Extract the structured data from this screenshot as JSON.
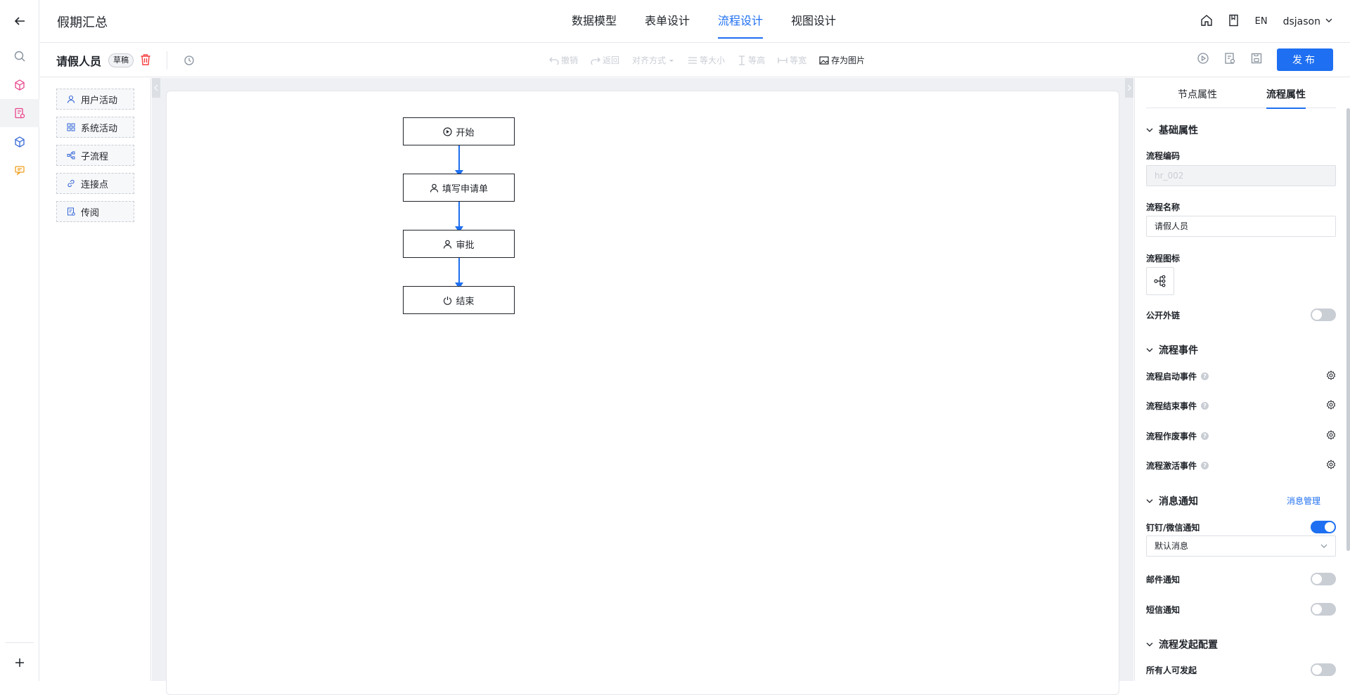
{
  "header": {
    "app_title": "假期汇总",
    "tabs": [
      {
        "label": "数据模型"
      },
      {
        "label": "表单设计"
      },
      {
        "label": "流程设计",
        "active": true
      },
      {
        "label": "视图设计"
      }
    ],
    "lang": "EN",
    "user": "dsjason"
  },
  "toolbar": {
    "flow_name": "请假人员",
    "status_badge": "草稿",
    "undo": "撤销",
    "redo": "返回",
    "align": "对齐方式",
    "same_size": "等大小",
    "same_height": "等高",
    "same_width": "等宽",
    "save_image": "存为图片",
    "publish": "发布"
  },
  "palette": {
    "items": [
      {
        "label": "用户活动",
        "icon": "user-icon"
      },
      {
        "label": "系统活动",
        "icon": "grid-icon"
      },
      {
        "label": "子流程",
        "icon": "subprocess-icon"
      },
      {
        "label": "连接点",
        "icon": "link-icon"
      },
      {
        "label": "传阅",
        "icon": "circulate-icon"
      }
    ]
  },
  "canvas": {
    "nodes": [
      {
        "label": "开始",
        "icon": "play-circle-icon"
      },
      {
        "label": "填写申请单",
        "icon": "user-icon"
      },
      {
        "label": "审批",
        "icon": "user-icon"
      },
      {
        "label": "结束",
        "icon": "power-icon"
      }
    ]
  },
  "panel": {
    "tabs": [
      {
        "label": "节点属性"
      },
      {
        "label": "流程属性",
        "active": true
      }
    ],
    "basic": {
      "title": "基础属性",
      "code_label": "流程编码",
      "code_value": "hr_002",
      "name_label": "流程名称",
      "name_value": "请假人员",
      "icon_label": "流程图标",
      "public_label": "公开外链",
      "public_on": false
    },
    "events": {
      "title": "流程事件",
      "items": [
        {
          "label": "流程启动事件"
        },
        {
          "label": "流程结束事件"
        },
        {
          "label": "流程作废事件"
        },
        {
          "label": "流程激活事件"
        }
      ]
    },
    "notify": {
      "title": "消息通知",
      "manage_link": "消息管理",
      "dingtalk_label": "钉钉/微信通知",
      "dingtalk_on": true,
      "dingtalk_select": "默认消息",
      "email_label": "邮件通知",
      "email_on": false,
      "sms_label": "短信通知",
      "sms_on": false
    },
    "launch": {
      "title": "流程发起配置",
      "everyone_label": "所有人可发起",
      "everyone_on": false
    }
  },
  "colors": {
    "accent": "#1e6ff1",
    "danger": "#f53f3f"
  }
}
